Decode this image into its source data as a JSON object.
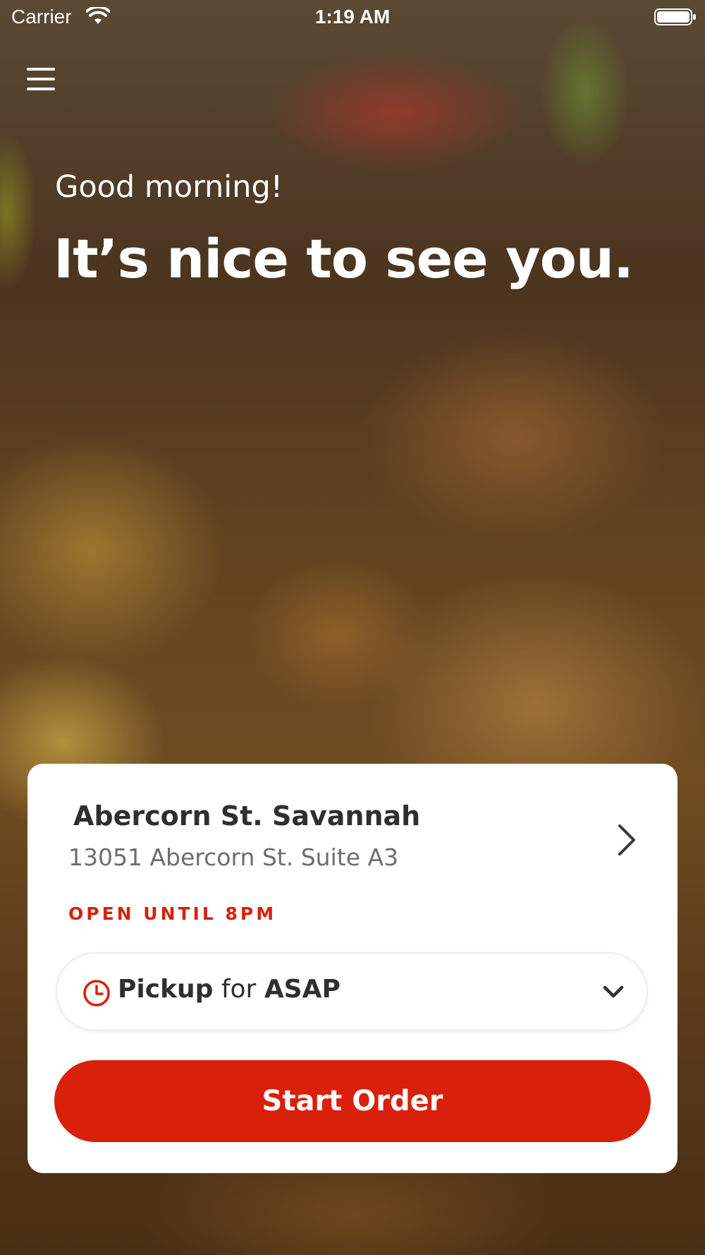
{
  "status_bar": {
    "carrier": "Carrier",
    "time": "1:19 AM",
    "wifi_icon": "wifi-icon",
    "battery_icon": "battery-icon"
  },
  "header": {
    "menu_icon": "hamburger-menu-icon"
  },
  "hero": {
    "greeting": "Good morning!",
    "headline": "It’s nice to see you."
  },
  "store_card": {
    "name": "Abercorn St. Savannah",
    "address": "13051 Abercorn St. Suite A3",
    "open_status": "OPEN UNTIL 8PM",
    "chevron_icon": "chevron-right-icon",
    "pickup": {
      "icon": "clock-icon",
      "mode": "Pickup",
      "connector": "for",
      "time": "ASAP",
      "dropdown_icon": "chevron-down-icon"
    },
    "start_order_label": "Start Order"
  },
  "colors": {
    "accent": "#d9200b",
    "text_dark": "#2f2f2f",
    "text_muted": "#6d6d6d"
  }
}
